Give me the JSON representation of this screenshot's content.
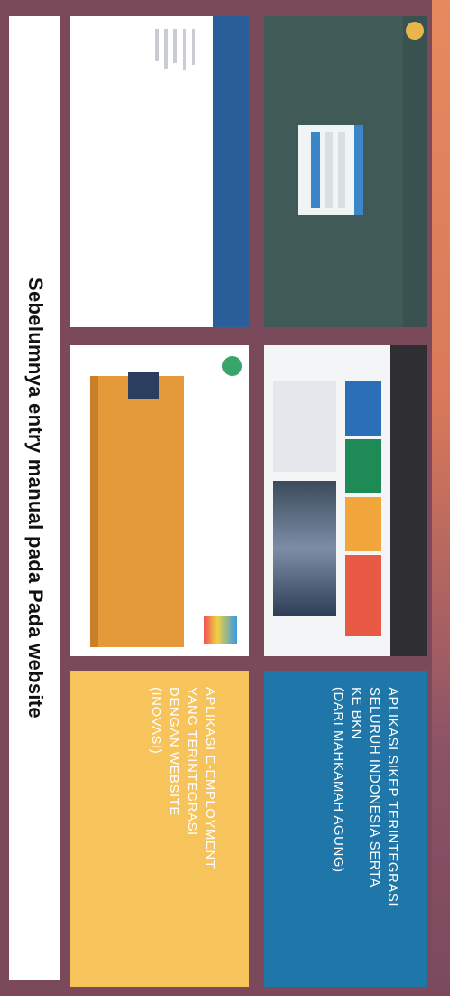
{
  "blue_block": {
    "lines": [
      "APLIKASI SIKEP TERINTEGRASI",
      "SELURUH INDONESIA SERTA",
      "KE BKN",
      "(DARI MAHKAMAH AGUNG)"
    ]
  },
  "yellow_block": {
    "lines": [
      "APLIKASI E-EMPLOYMENT",
      "YANG TERINTEGRASI",
      "DENGAN WEBSITE",
      "(INOVASI)"
    ]
  },
  "caption": "Sebelumnya entry manual pada Pada website",
  "colors": {
    "blue": "#1f76a8",
    "yellow": "#f7c35b",
    "background": "#7b4a5a",
    "login_bg": "#3f5a57",
    "web_header": "#2b5f9a",
    "orange_band": "#e49a3a"
  }
}
